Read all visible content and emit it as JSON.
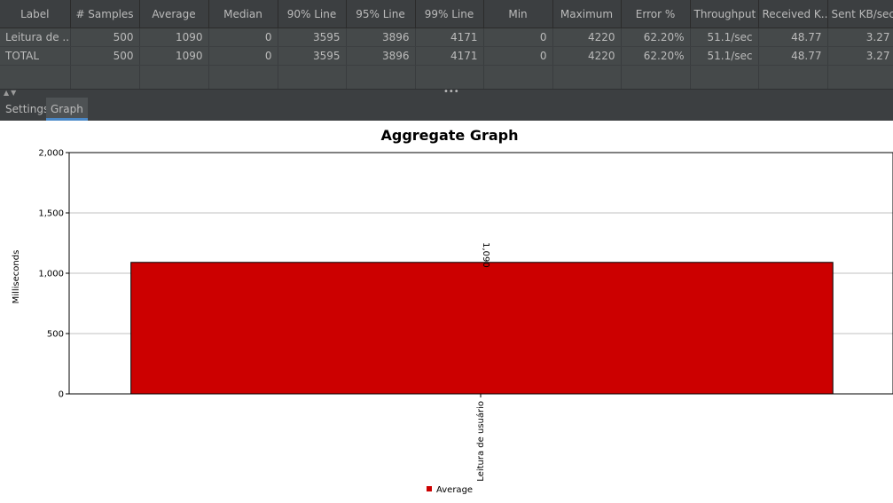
{
  "table": {
    "headers": [
      "Label",
      "# Samples",
      "Average",
      "Median",
      "90% Line",
      "95% Line",
      "99% Line",
      "Min",
      "Maximum",
      "Error %",
      "Throughput",
      "Received K...",
      "Sent KB/sec"
    ],
    "rows": [
      [
        "Leitura de ...",
        "500",
        "1090",
        "0",
        "3595",
        "3896",
        "4171",
        "0",
        "4220",
        "62.20%",
        "51.1/sec",
        "48.77",
        "3.27"
      ],
      [
        "TOTAL",
        "500",
        "1090",
        "0",
        "3595",
        "3896",
        "4171",
        "0",
        "4220",
        "62.20%",
        "51.1/sec",
        "48.77",
        "3.27"
      ]
    ]
  },
  "tabs": {
    "settings": "Settings",
    "graph": "Graph"
  },
  "chart_data": {
    "type": "bar",
    "title": "Aggregate Graph",
    "ylabel": "Milliseconds",
    "xlabel": "",
    "categories": [
      "Leitura de usuário"
    ],
    "series": [
      {
        "name": "Average",
        "values": [
          1090
        ],
        "color": "#cc0000"
      }
    ],
    "ylim": [
      0,
      2000
    ],
    "yticks": [
      0,
      500,
      1000,
      1500,
      2000
    ],
    "ytick_labels": [
      "0",
      "500",
      "1,000",
      "1,500",
      "2,000"
    ],
    "data_labels": [
      "1,090"
    ],
    "grid": true,
    "legend": "bottom"
  }
}
